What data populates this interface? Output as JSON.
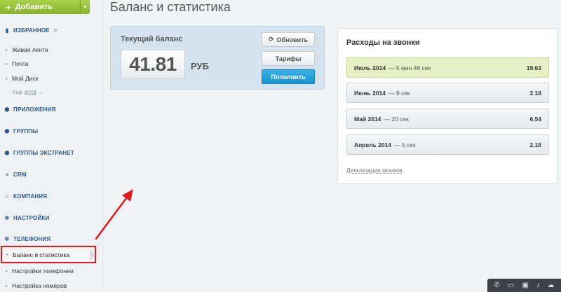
{
  "sidebar": {
    "add_button": "Добавить",
    "favorites": {
      "label": "ИЗБРАННОЕ",
      "items": [
        "Живая лента",
        "Почта",
        "Мой Диск"
      ],
      "more_label": "Ещё",
      "more_count": "50+"
    },
    "sections": [
      "ПРИЛОЖЕНИЯ",
      "ГРУППЫ",
      "ГРУППЫ ЭКСТРАНЕТ",
      "CRM",
      "КОМПАНИЯ",
      "НАСТРОЙКИ",
      "ТЕЛЕФОНИЯ"
    ],
    "telephony_items": [
      "Баланс и статистика",
      "Настройки телефонии",
      "Настройка номеров"
    ]
  },
  "page": {
    "title": "Баланс и статистика"
  },
  "balance": {
    "title": "Текущий баланс",
    "amount": "41.81",
    "currency": "РУБ",
    "refresh_label": "Обновить",
    "tariffs_label": "Тарифы",
    "topup_label": "Пополнить"
  },
  "calls": {
    "title": "Расходы на звонки",
    "rows": [
      {
        "month": "Июль 2014",
        "duration": "— 5 мин 48 сек",
        "amount": "19.63"
      },
      {
        "month": "Июнь 2014",
        "duration": "— 9 сек",
        "amount": "2.18"
      },
      {
        "month": "Май 2014",
        "duration": "— 20 сек",
        "amount": "6.54"
      },
      {
        "month": "Апрель 2014",
        "duration": "— 5 сек",
        "amount": "2.18"
      }
    ],
    "details_link": "Детализация звонков"
  },
  "colors": {
    "accent_green": "#8dbb32",
    "accent_blue": "#1a93cf",
    "highlight_red": "#e0191e",
    "row_highlight": "#e6f0c4"
  },
  "toolbar_icons": [
    "phone-icon",
    "chat-icon",
    "desktop-icon",
    "bell-icon",
    "cloud-icon"
  ]
}
